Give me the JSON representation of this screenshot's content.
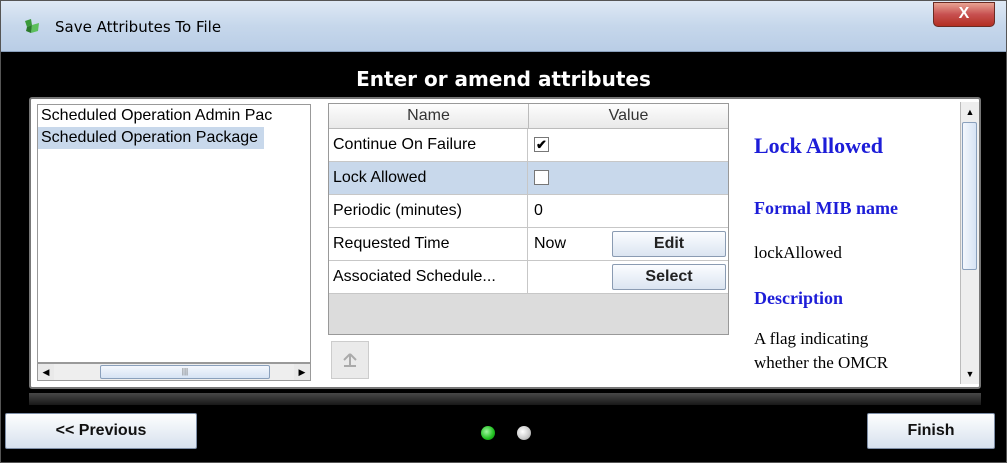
{
  "window": {
    "title": "Save Attributes To File",
    "close_label": "X"
  },
  "header": {
    "title": "Enter or amend attributes"
  },
  "left_list": {
    "items": [
      {
        "label": "Scheduled Operation Admin Pac",
        "selected": false
      },
      {
        "label": "Scheduled Operation Package",
        "selected": true
      }
    ]
  },
  "table": {
    "columns": [
      "Name",
      "Value"
    ],
    "rows": [
      {
        "name": "Continue On Failure",
        "value": "",
        "checked": true
      },
      {
        "name": "Lock Allowed",
        "value": "",
        "checked": false,
        "selected": true
      },
      {
        "name": "Periodic (minutes)",
        "value": "0"
      },
      {
        "name": "Requested Time",
        "value": "Now",
        "button": "Edit"
      },
      {
        "name": "Associated Schedule...",
        "value": "",
        "button": "Select"
      }
    ]
  },
  "doc": {
    "title": "Lock Allowed",
    "formal_heading": "Formal MIB name",
    "formal_value": "lockAllowed",
    "description_heading": "Description",
    "description_line1": "A flag indicating",
    "description_line2": "whether the OMCR"
  },
  "footer": {
    "previous_label": "<< Previous",
    "finish_label": "Finish",
    "step_indicator": {
      "current": 1,
      "total": 2
    },
    "colors": {
      "active": "#2fd12f",
      "inactive": "#d8d8d8"
    }
  },
  "icons": [
    "app-icon",
    "up-arrow-icon"
  ]
}
